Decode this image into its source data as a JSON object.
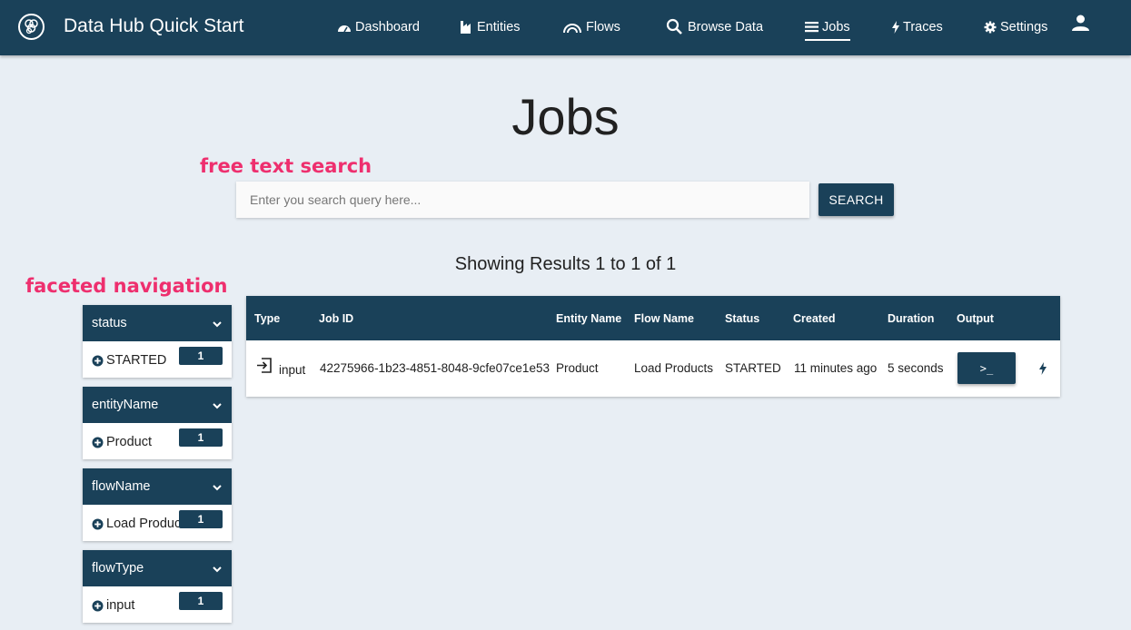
{
  "header": {
    "app_title": "Data Hub Quick Start",
    "nav": [
      {
        "label": "Dashboard",
        "icon": "dashboard-icon"
      },
      {
        "label": "Entities",
        "icon": "entities-icon"
      },
      {
        "label": "Flows",
        "icon": "flows-icon"
      },
      {
        "label": "Browse Data",
        "icon": "search-icon"
      },
      {
        "label": "Jobs",
        "icon": "jobs-icon",
        "active": true
      },
      {
        "label": "Traces",
        "icon": "bolt-icon"
      },
      {
        "label": "Settings",
        "icon": "gear-icon"
      }
    ],
    "user_icon": "user-icon"
  },
  "page": {
    "title": "Jobs",
    "annotations": {
      "search": "free text search",
      "facets": "faceted navigation"
    },
    "search": {
      "placeholder": "Enter you search query here...",
      "value": "",
      "button_label": "SEARCH"
    },
    "results_summary": "Showing Results 1 to 1 of 1"
  },
  "facets": [
    {
      "name": "status",
      "value": "STARTED",
      "count": "1"
    },
    {
      "name": "entityName",
      "value": "Product",
      "count": "1"
    },
    {
      "name": "flowName",
      "value": "Load Products",
      "count": "1"
    },
    {
      "name": "flowType",
      "value": "input",
      "count": "1"
    }
  ],
  "table": {
    "columns": [
      "Type",
      "Job ID",
      "Entity Name",
      "Flow Name",
      "Status",
      "Created",
      "Duration",
      "Output"
    ],
    "rows": [
      {
        "type": "input",
        "job_id": "42275966-1b23-4851-8048-9cfe07ce1e53",
        "entity_name": "Product",
        "flow_name": "Load Products",
        "status": "STARTED",
        "created": "11 minutes ago",
        "duration": "5 seconds",
        "output_button": ">_"
      }
    ]
  },
  "colors": {
    "brand": "#1a4159",
    "background": "#e8eef4",
    "annotation": "#ee2f6e"
  }
}
